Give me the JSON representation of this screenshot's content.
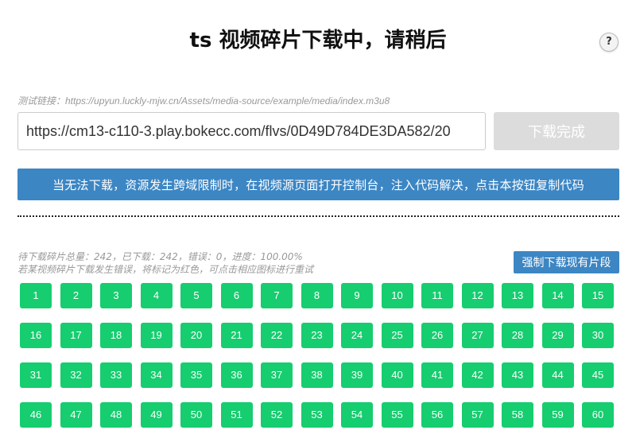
{
  "header": {
    "title": "ts 视频碎片下载中，请稍后",
    "help_label": "?"
  },
  "form": {
    "test_link": "测试链接：https://upyun.luckly-mjw.cn/Assets/media-source/example/media/index.m3u8",
    "url_value": "https://cm13-c110-3.play.bokecc.com/flvs/0D49D784DE3DA582/20",
    "download_done_label": "下载完成"
  },
  "copy_code_label": "当无法下载，资源发生跨域限制时，在视频源页面打开控制台，注入代码解决，点击本按钮复制代码",
  "status": {
    "stats_line": "待下载碎片总量：242，已下载：242，错误：0，进度：100.00%",
    "error_hint": "若某视频碎片下载发生错误，将标记为红色，可点击相应图标进行重试",
    "force_download_label": "强制下载现有片段"
  },
  "segments": {
    "completed_color": "#16cd6f",
    "items": [
      "1",
      "2",
      "3",
      "4",
      "5",
      "6",
      "7",
      "8",
      "9",
      "10",
      "11",
      "12",
      "13",
      "14",
      "15",
      "16",
      "17",
      "18",
      "19",
      "20",
      "21",
      "22",
      "23",
      "24",
      "25",
      "26",
      "27",
      "28",
      "29",
      "30",
      "31",
      "32",
      "33",
      "34",
      "35",
      "36",
      "37",
      "38",
      "39",
      "40",
      "41",
      "42",
      "43",
      "44",
      "45",
      "46",
      "47",
      "48",
      "49",
      "50",
      "51",
      "52",
      "53",
      "54",
      "55",
      "56",
      "57",
      "58",
      "59",
      "60"
    ]
  },
  "colors": {
    "primary_button": "#3c86c4",
    "disabled_button": "#dcdcdc",
    "segment_done": "#16cd6f"
  }
}
